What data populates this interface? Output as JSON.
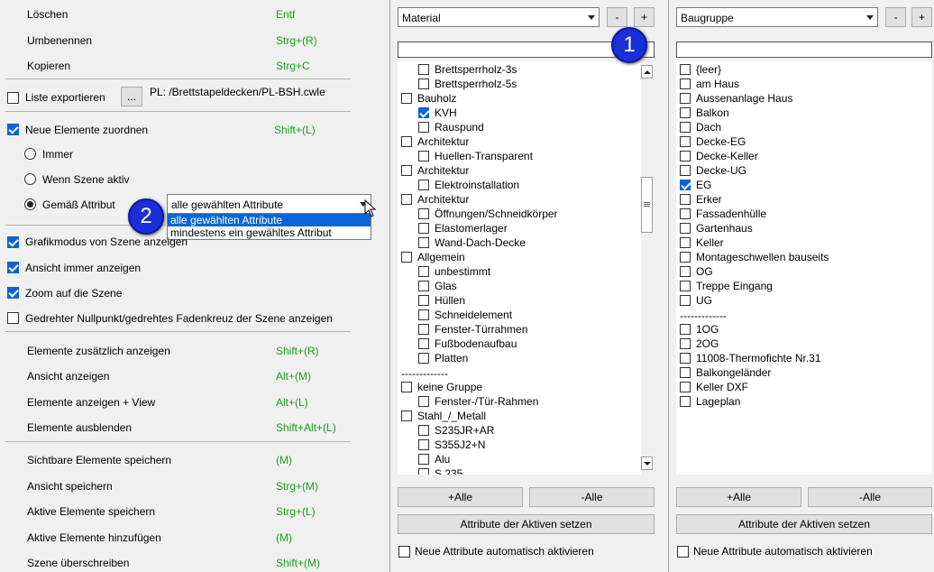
{
  "left": {
    "menu1": [
      {
        "label": "Löschen",
        "shortcut": "Entf"
      },
      {
        "label": "Umbenennen",
        "shortcut": "Strg+(R)"
      },
      {
        "label": "Kopieren",
        "shortcut": "Strg+C"
      }
    ],
    "export_label": "Liste exportieren",
    "browse_label": "...",
    "path_text": "PL:  /Brettstapeldecken/PL-BSH.cwle",
    "assign_label": "Neue Elemente zuordnen",
    "assign_shortcut": "Shift+(L)",
    "radio": [
      "Immer",
      "Wenn Szene aktiv",
      "Gemäß Attribut"
    ],
    "attr_combo_value": "alle gewählten Attribute",
    "attr_options": [
      "alle gewählten Attribute",
      "mindestens ein gewähltes Attribut"
    ],
    "checks": [
      "Grafikmodus von Szene anzeigen",
      "Ansicht immer anzeigen",
      "Zoom auf die Szene",
      "Gedrehter Nullpunkt/gedrehtes Fadenkreuz der Szene anzeigen"
    ],
    "menu2": [
      {
        "label": "Elemente zusätzlich anzeigen",
        "shortcut": "Shift+(R)"
      },
      {
        "label": "Ansicht anzeigen",
        "shortcut": "Alt+(M)"
      },
      {
        "label": "Elemente anzeigen + View",
        "shortcut": "Alt+(L)"
      },
      {
        "label": "Elemente ausblenden",
        "shortcut": "Shift+Alt+(L)"
      }
    ],
    "menu3": [
      {
        "label": "Sichtbare Elemente speichern",
        "shortcut": "(M)"
      },
      {
        "label": "Ansicht speichern",
        "shortcut": "Strg+(M)"
      },
      {
        "label": "Aktive Elemente speichern",
        "shortcut": "Strg+(L)"
      },
      {
        "label": "Aktive Elemente hinzufügen",
        "shortcut": "(M)"
      },
      {
        "label": "Szene überschreiben",
        "shortcut": "Shift+(M)"
      }
    ]
  },
  "badges": [
    "1",
    "2"
  ],
  "material": {
    "combo": "Material",
    "minus": "-",
    "plus": "+",
    "items": [
      {
        "label": "Brettsperrholz-3s",
        "level": 1,
        "checked": false
      },
      {
        "label": "Brettsperrholz-5s",
        "level": 1,
        "checked": false
      },
      {
        "label": "Bauholz",
        "level": 0,
        "checked": false
      },
      {
        "label": "KVH",
        "level": 1,
        "checked": true
      },
      {
        "label": "Rauspund",
        "level": 1,
        "checked": false
      },
      {
        "label": "Architektur",
        "level": 0,
        "checked": false
      },
      {
        "label": "Huellen-Transparent",
        "level": 1,
        "checked": false
      },
      {
        "label": "Architektur",
        "level": 0,
        "checked": false
      },
      {
        "label": "Elektroinstallation",
        "level": 1,
        "checked": false
      },
      {
        "label": "Architektur",
        "level": 0,
        "checked": false
      },
      {
        "label": "Öffnungen/Schneidkörper",
        "level": 1,
        "checked": false
      },
      {
        "label": "Elastomerlager",
        "level": 1,
        "checked": false
      },
      {
        "label": "Wand-Dach-Decke",
        "level": 1,
        "checked": false
      },
      {
        "label": "Allgemein",
        "level": 0,
        "checked": false
      },
      {
        "label": "unbestimmt",
        "level": 1,
        "checked": false
      },
      {
        "label": "Glas",
        "level": 1,
        "checked": false
      },
      {
        "label": "Hüllen",
        "level": 1,
        "checked": false
      },
      {
        "label": "Schneidelement",
        "level": 1,
        "checked": false
      },
      {
        "label": "Fenster-Türrahmen",
        "level": 1,
        "checked": false
      },
      {
        "label": "Fußbodenaufbau",
        "level": 1,
        "checked": false
      },
      {
        "label": "Platten",
        "level": 1,
        "checked": false
      },
      {
        "label": "-------------",
        "level": -1,
        "checked": false
      },
      {
        "label": "keine Gruppe",
        "level": 0,
        "checked": false
      },
      {
        "label": "Fenster-/Tür-Rahmen",
        "level": 1,
        "checked": false
      },
      {
        "label": "Stahl_/_Metall",
        "level": 0,
        "checked": false
      },
      {
        "label": "S235JR+AR",
        "level": 1,
        "checked": false
      },
      {
        "label": "S355J2+N",
        "level": 1,
        "checked": false
      },
      {
        "label": "Alu",
        "level": 1,
        "checked": false
      },
      {
        "label": "S 235",
        "level": 1,
        "checked": false
      }
    ],
    "all_plus": "+Alle",
    "all_minus": "-Alle",
    "set_attr": "Attribute der Aktiven setzen",
    "auto_label": "Neue Attribute automatisch aktivieren"
  },
  "baugruppe": {
    "combo": "Baugruppe",
    "minus": "-",
    "plus": "+",
    "items": [
      {
        "label": "{leer}",
        "checked": false
      },
      {
        "label": "am Haus",
        "checked": false
      },
      {
        "label": "Aussenanlage Haus",
        "checked": false
      },
      {
        "label": "Balkon",
        "checked": false
      },
      {
        "label": "Dach",
        "checked": false
      },
      {
        "label": "Decke-EG",
        "checked": false
      },
      {
        "label": "Decke-Keller",
        "checked": false
      },
      {
        "label": "Decke-UG",
        "checked": false
      },
      {
        "label": "EG",
        "checked": true
      },
      {
        "label": "Erker",
        "checked": false
      },
      {
        "label": "Fassadenhülle",
        "checked": false
      },
      {
        "label": "Gartenhaus",
        "checked": false
      },
      {
        "label": "Keller",
        "checked": false
      },
      {
        "label": "Montageschwellen bauseits",
        "checked": false
      },
      {
        "label": "OG",
        "checked": false
      },
      {
        "label": "Treppe Eingang",
        "checked": false
      },
      {
        "label": "UG",
        "checked": false
      },
      {
        "label": "-------------",
        "sep": true
      },
      {
        "label": "1OG",
        "checked": false
      },
      {
        "label": "2OG",
        "checked": false
      },
      {
        "label": "11008-Thermofichte Nr.31",
        "checked": false
      },
      {
        "label": "Balkongeländer",
        "checked": false
      },
      {
        "label": "Keller DXF",
        "checked": false
      },
      {
        "label": "Lageplan",
        "checked": false
      }
    ],
    "all_plus": "+Alle",
    "all_minus": "-Alle",
    "set_attr": "Attribute der Aktiven setzen",
    "auto_label": "Neue Attribute automatisch aktivieren"
  },
  "colors": {
    "shortcut": "#17a317",
    "badge": "#1a2fd8",
    "selection": "#0a64d6"
  }
}
